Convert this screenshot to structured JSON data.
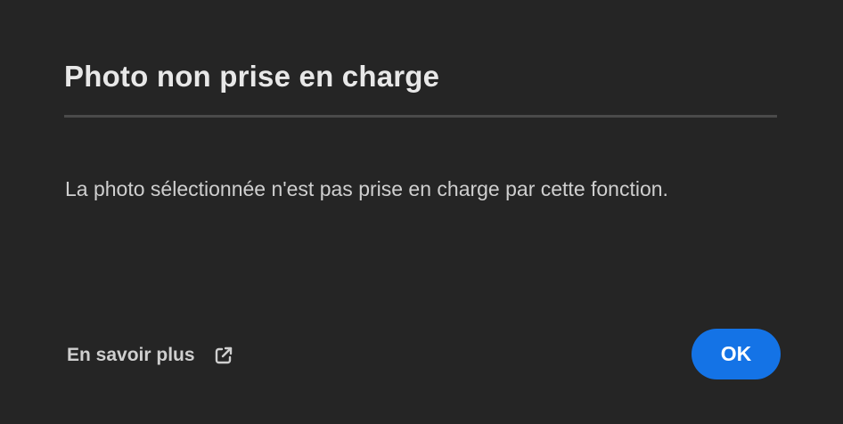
{
  "dialog": {
    "title": "Photo non prise en charge",
    "message": "La photo sélectionnée n'est pas prise en charge par cette fonction.",
    "learn_more_label": "En savoir plus",
    "learn_more_icon": "external-link-icon",
    "ok_label": "OK"
  },
  "colors": {
    "background": "#252525",
    "title_text": "#e8e8e8",
    "body_text": "#cfcfcf",
    "divider": "#4a4a4a",
    "accent": "#1473e6"
  }
}
